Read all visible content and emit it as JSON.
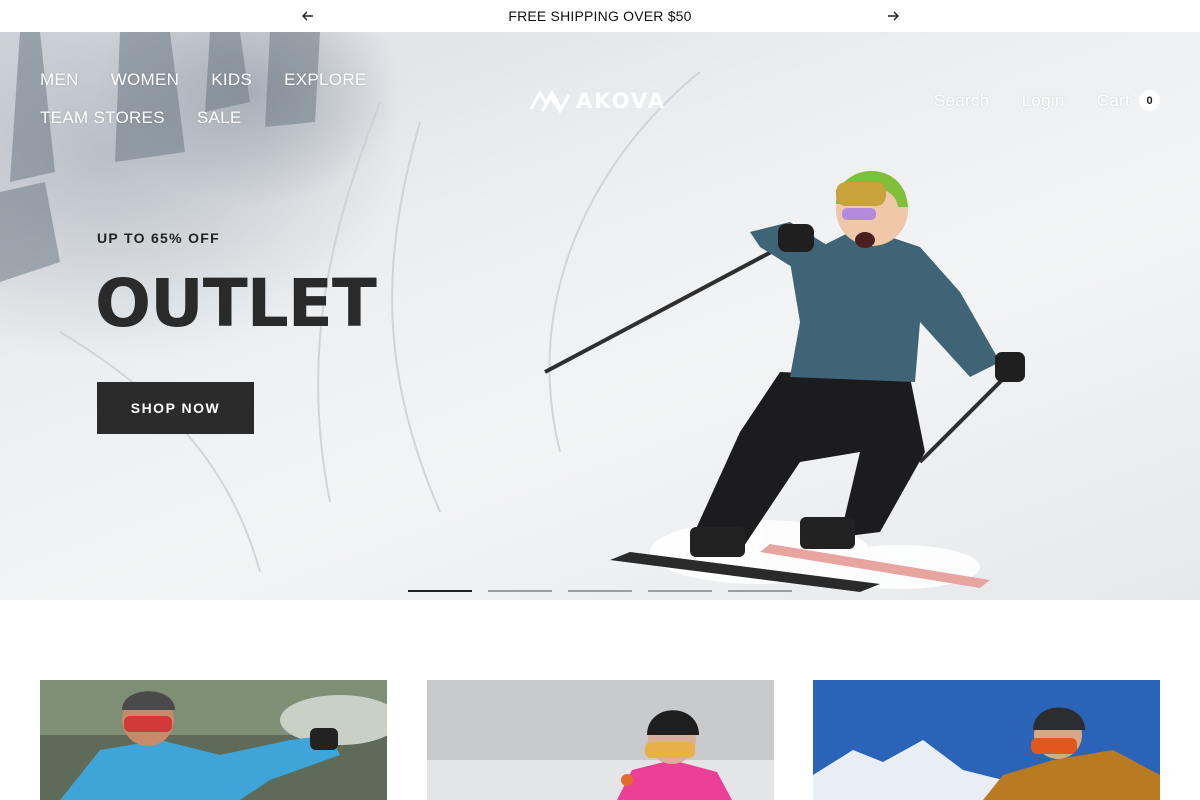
{
  "announcement": {
    "text": "FREE SHIPPING OVER $50",
    "prev_icon": "arrow-left-icon",
    "next_icon": "arrow-right-icon"
  },
  "header": {
    "nav_left": [
      "MEN",
      "WOMEN",
      "KIDS",
      "EXPLORE",
      "TEAM STORES",
      "SALE"
    ],
    "logo_text": "AKOVA",
    "search_label": "Search",
    "login_label": "Login",
    "cart_label": "Cart",
    "cart_count": "0"
  },
  "hero": {
    "subtitle": "UP TO 65% OFF",
    "title": "OUTLET",
    "cta_label": "SHOP NOW",
    "slides": {
      "count": 5,
      "active": 1
    }
  },
  "cards": [
    {
      "image": "skier-blue-jacket-beanie"
    },
    {
      "image": "skier-pink-jacket-helmet"
    },
    {
      "image": "skier-orange-jacket-mountains"
    }
  ],
  "colors": {
    "cta_background": "#2b2b2b",
    "nav_text": "#ffffff",
    "jacket_teal": "#3f6476"
  }
}
